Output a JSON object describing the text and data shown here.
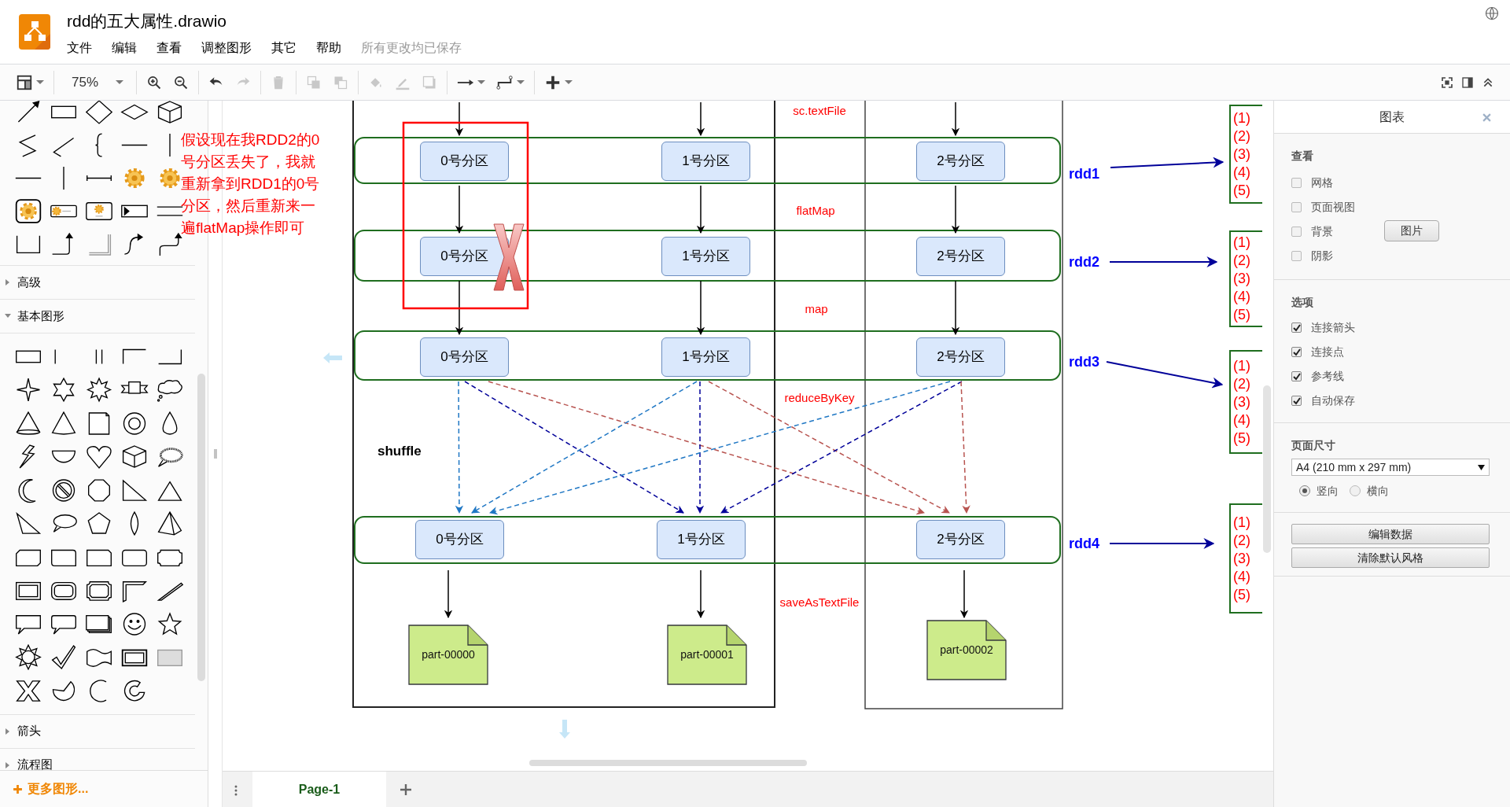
{
  "app": {
    "title": "rdd的五大属性.drawio",
    "menu": [
      "文件",
      "编辑",
      "查看",
      "调整图形",
      "其它",
      "帮助"
    ],
    "save_status": "所有更改均已保存"
  },
  "toolbar": {
    "groups": [
      [
        {
          "kind": "layout",
          "disabled": false
        }
      ],
      [
        {
          "kind": "zoom",
          "value": "75%",
          "disabled": false
        }
      ],
      [
        {
          "kind": "zoom_in",
          "disabled": false
        },
        {
          "kind": "zoom_out",
          "disabled": false
        }
      ],
      [
        {
          "kind": "undo",
          "disabled": false
        },
        {
          "kind": "redo",
          "disabled": true
        }
      ],
      [
        {
          "kind": "delete",
          "disabled": true
        }
      ],
      [
        {
          "kind": "to_front",
          "disabled": true
        },
        {
          "kind": "to_back",
          "disabled": true
        }
      ],
      [
        {
          "kind": "fill_color",
          "disabled": true
        },
        {
          "kind": "line_color",
          "disabled": true
        },
        {
          "kind": "shadow",
          "disabled": true
        }
      ],
      [
        {
          "kind": "connection",
          "disabled": false
        },
        {
          "kind": "waypoints",
          "disabled": false
        }
      ],
      [
        {
          "kind": "insert",
          "disabled": false
        }
      ]
    ],
    "right_tools": [
      {
        "kind": "fullscreen",
        "disabled": false
      },
      {
        "kind": "format_panel",
        "disabled": false
      },
      {
        "kind": "collapse",
        "disabled": false
      }
    ]
  },
  "sidebar": {
    "sections": [
      {
        "label": "高级",
        "expanded": false
      },
      {
        "label": "基本图形",
        "expanded": true
      },
      {
        "label": "箭头",
        "expanded": false
      },
      {
        "label": "流程图",
        "expanded": false
      }
    ],
    "more_shapes": "更多图形..."
  },
  "diagram": {
    "annotation": "假设现在我RDD2的0号分区丢失了，我就重新拿到RDD1的0号分区，然后重新来一遍flatMap操作即可",
    "operations": [
      "sc.textFile",
      "flatMap",
      "map",
      "reduceByKey",
      "saveAsTextFile"
    ],
    "shuffle_label": "shuffle",
    "rdds": [
      {
        "label": "rdd1",
        "partitions": [
          {
            "label": "0号分区",
            "lost": false
          },
          {
            "label": "1号分区",
            "lost": false
          },
          {
            "label": "2号分区",
            "lost": false
          }
        ],
        "notes": [
          "(1)",
          "(2)",
          "(3)",
          "(4)",
          "(5)"
        ]
      },
      {
        "label": "rdd2",
        "partitions": [
          {
            "label": "0号分区",
            "lost": true
          },
          {
            "label": "1号分区",
            "lost": false
          },
          {
            "label": "2号分区",
            "lost": false
          }
        ],
        "notes": [
          "(1)",
          "(2)",
          "(3)",
          "(4)",
          "(5)"
        ]
      },
      {
        "label": "rdd3",
        "partitions": [
          {
            "label": "0号分区",
            "lost": false
          },
          {
            "label": "1号分区",
            "lost": false
          },
          {
            "label": "2号分区",
            "lost": false
          }
        ],
        "notes": [
          "(1)",
          "(2)",
          "(3)",
          "(4)",
          "(5)"
        ]
      },
      {
        "label": "rdd4",
        "partitions": [
          {
            "label": "0号分区",
            "lost": false
          },
          {
            "label": "1号分区",
            "lost": false
          },
          {
            "label": "2号分区",
            "lost": false
          }
        ],
        "notes": [
          "(1)",
          "(2)",
          "(3)",
          "(4)",
          "(5)"
        ]
      }
    ],
    "files": [
      "part-00000",
      "part-00001",
      "part-00002"
    ]
  },
  "format_panel": {
    "title": "图表",
    "view": {
      "heading": "查看",
      "options": [
        {
          "label": "网格",
          "checked": false
        },
        {
          "label": "页面视图",
          "checked": false
        },
        {
          "label": "背景",
          "checked": false
        },
        {
          "label": "阴影",
          "checked": false
        }
      ],
      "image_button": "图片"
    },
    "options": {
      "heading": "选项",
      "options": [
        {
          "label": "连接箭头",
          "checked": true
        },
        {
          "label": "连接点",
          "checked": true
        },
        {
          "label": "参考线",
          "checked": true
        },
        {
          "label": "自动保存",
          "checked": true
        }
      ]
    },
    "page_size": {
      "heading": "页面尺寸",
      "value": "A4 (210 mm x 297 mm)",
      "orientations": [
        {
          "label": "竖向",
          "selected": true
        },
        {
          "label": "横向",
          "selected": false
        }
      ]
    },
    "buttons": [
      "编辑数据",
      "清除默认风格"
    ]
  },
  "pages": [
    {
      "label": "Page-1",
      "selected": true
    }
  ]
}
